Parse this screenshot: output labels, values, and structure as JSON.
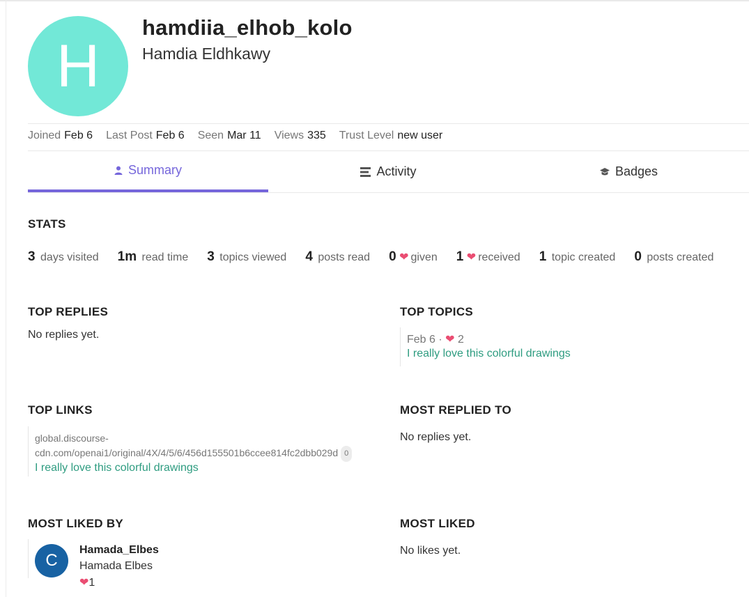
{
  "profile": {
    "avatar_letter": "H",
    "avatar_color": "#72e8d7",
    "username": "hamdiia_elhob_kolo",
    "full_name": "Hamdia Eldhkawy"
  },
  "meta": {
    "joined_label": "Joined",
    "joined_value": "Feb 6",
    "last_post_label": "Last Post",
    "last_post_value": "Feb 6",
    "seen_label": "Seen",
    "seen_value": "Mar 11",
    "views_label": "Views",
    "views_value": "335",
    "trust_label": "Trust Level",
    "trust_value": "new user"
  },
  "tabs": [
    {
      "label": "Summary",
      "icon": "user-icon",
      "active": true
    },
    {
      "label": "Activity",
      "icon": "stream-icon",
      "active": false
    },
    {
      "label": "Badges",
      "icon": "certificate-icon",
      "active": false
    }
  ],
  "accent_color": "#7566db",
  "stats": {
    "title": "STATS",
    "days_visited": {
      "num": "3",
      "label": "days visited"
    },
    "read_time": {
      "num": "1m",
      "label": "read time"
    },
    "topics_viewed": {
      "num": "3",
      "label": "topics viewed"
    },
    "posts_read": {
      "num": "4",
      "label": "posts read"
    },
    "given": {
      "num": "0",
      "label": "given"
    },
    "received": {
      "num": "1",
      "label": "received"
    },
    "topic_created": {
      "num": "1",
      "label": "topic created"
    },
    "posts_created": {
      "num": "0",
      "label": "posts created"
    }
  },
  "top_replies": {
    "title": "TOP REPLIES",
    "empty": "No replies yet."
  },
  "top_topics": {
    "title": "TOP TOPICS",
    "date": "Feb 6",
    "separator": "·",
    "likes": "2",
    "topic": "I really love this colorful drawings"
  },
  "top_links": {
    "title": "TOP LINKS",
    "url_line1": "global.discourse-",
    "url_line2": "cdn.com/openai1/original/4X/4/5/6/456d155501b6ccee814fc2dbb029d",
    "clicks": "0",
    "topic": "I really love this colorful drawings"
  },
  "most_replied_to": {
    "title": "MOST REPLIED TO",
    "empty": "No replies yet."
  },
  "most_liked_by": {
    "title": "MOST LIKED BY",
    "avatar_letter": "C",
    "avatar_color": "#1862a3",
    "username": "Hamada_Elbes",
    "name": "Hamada Elbes",
    "count": "1"
  },
  "most_liked": {
    "title": "MOST LIKED",
    "empty": "No likes yet."
  },
  "link_color": "#2e9c80",
  "heart_color": "#ea4d72"
}
